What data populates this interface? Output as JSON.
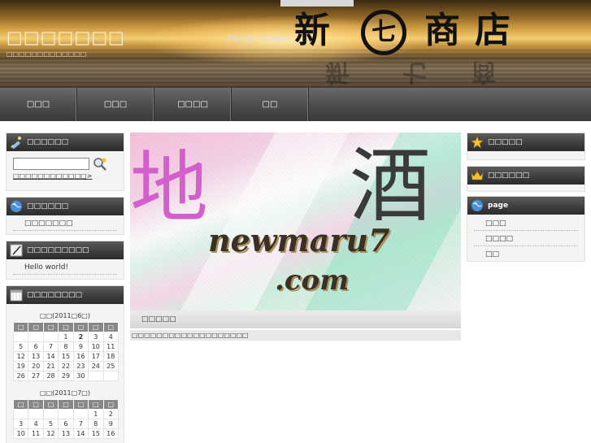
{
  "header": {
    "site_title": "□□□□□□□",
    "site_tagline": "□□□□□□□□□□□□□",
    "overlay_text": "Pacific  Ocean",
    "logo_chars": [
      "新",
      "七",
      "商",
      "店"
    ],
    "colors": {
      "sky_top": "#3a2a12",
      "sun": "#f2cd72",
      "sea": "#5f4a2c"
    }
  },
  "nav": {
    "items": [
      {
        "label": "□□□"
      },
      {
        "label": "□□□"
      },
      {
        "label": "□□□□"
      },
      {
        "label": "□□"
      }
    ]
  },
  "left_sidebar": {
    "search": {
      "title": "□□□□□□",
      "icon": "pencil-icon",
      "placeholder": "",
      "value": "",
      "button_icon": "magnifier-icon",
      "more_link": "□□□□□□□□□□□□>"
    },
    "categories": {
      "title": "□□□□□□",
      "icon": "globe-icon",
      "items": [
        "□□□□□□□"
      ]
    },
    "recent_posts": {
      "title": "□□□□□□□□□",
      "icon": "pen-icon",
      "items": [
        "Hello world!"
      ]
    },
    "calendar": {
      "title": "□□□□□□□□",
      "icon": "calendar-icon",
      "weekdays": [
        "□",
        "□",
        "□",
        "□",
        "□",
        "□",
        "□"
      ],
      "months": [
        {
          "caption": "□□(2011□6□)",
          "rows": [
            [
              "",
              "",
              "",
              "1",
              "2",
              "3",
              "4"
            ],
            [
              "5",
              "6",
              "7",
              "8",
              "9",
              "10",
              "11"
            ],
            [
              "12",
              "13",
              "14",
              "15",
              "16",
              "17",
              "18"
            ],
            [
              "19",
              "20",
              "21",
              "22",
              "23",
              "24",
              "25"
            ],
            [
              "26",
              "27",
              "28",
              "29",
              "30",
              "",
              ""
            ]
          ],
          "today": "2"
        },
        {
          "caption": "□□(2011□7□)",
          "rows": [
            [
              "",
              "",
              "",
              "",
              "",
              "1",
              "2"
            ],
            [
              "3",
              "4",
              "5",
              "6",
              "7",
              "8",
              "9"
            ],
            [
              "10",
              "11",
              "12",
              "13",
              "14",
              "15",
              "16"
            ]
          ],
          "today": ""
        }
      ]
    }
  },
  "main": {
    "banner": {
      "kanji_left": "地",
      "kanji_right": "酒",
      "domain_line1": "newmaru7",
      "domain_line2": ".com",
      "colors": {
        "pink": "#f6c0dc",
        "mint": "#cfeede",
        "kanji_pink": "#d25fcc"
      }
    },
    "post_title": "□□□□□",
    "post_excerpt": "□□□□□□□□□□□□□□□□□□□"
  },
  "right_sidebar": {
    "widget1": {
      "title": "□□□□□",
      "icon": "star-icon"
    },
    "widget2": {
      "title": "□□□□□□",
      "icon": "crown-icon"
    },
    "pages": {
      "title": "page",
      "icon": "globe-icon",
      "items": [
        "□□□",
        "□□□□",
        "□□"
      ]
    }
  }
}
